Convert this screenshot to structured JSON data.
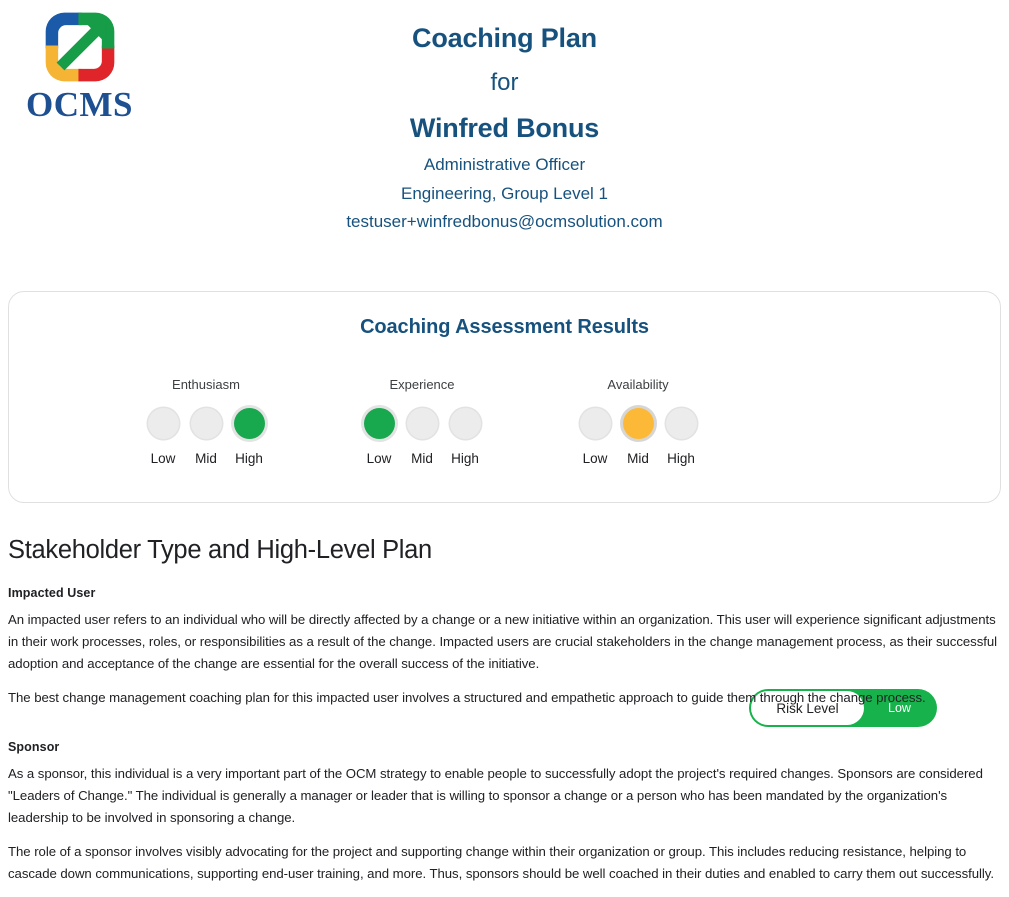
{
  "brand": {
    "logo_icon": "ocms-arrow-logo-icon",
    "name": "OCMS",
    "logo_colors": {
      "blue": "#1b5aa8",
      "green": "#179c48",
      "amber": "#f5b433",
      "red": "#e0252a"
    }
  },
  "header": {
    "title": "Coaching Plan",
    "for_word": "for",
    "person_name": "Winfred Bonus",
    "role": "Administrative Officer",
    "department": "Engineering, Group Level 1",
    "email": "testuser+winfredbonus@ocmsolution.com",
    "accent_color": "#17527e"
  },
  "assessment": {
    "card_title": "Coaching Assessment Results",
    "scale": [
      "Low",
      "Mid",
      "High"
    ],
    "meters": [
      {
        "label": "Enthusiasm",
        "selected": "High",
        "selected_index": 2,
        "state_color": "#18a84d"
      },
      {
        "label": "Experience",
        "selected": "Low",
        "selected_index": 0,
        "state_color": "#18a84d"
      },
      {
        "label": "Availability",
        "selected": "Mid",
        "selected_index": 1,
        "state_color": "#fcb938"
      }
    ],
    "risk": {
      "label": "Risk Level",
      "value": "Low",
      "color": "#18b24c"
    }
  },
  "plan_section": {
    "heading": "Stakeholder Type and High-Level Plan",
    "groups": [
      {
        "subheading": "Impacted User",
        "paragraphs": [
          "An impacted user refers to an individual who will be directly affected by a change or a new initiative within an organization. This user will experience significant adjustments in their work processes, roles, or responsibilities as a result of the change. Impacted users are crucial stakeholders in the change management process, as their successful adoption and acceptance of the change are essential for the overall success of the initiative.",
          "The best change management coaching plan for this impacted user involves a structured and empathetic approach to guide them through the change process."
        ]
      },
      {
        "subheading": "Sponsor",
        "paragraphs": [
          "As a sponsor, this individual is a very important part of the OCM strategy to enable people to successfully adopt the project's required changes. Sponsors are considered \"Leaders of Change.\" The individual is generally a manager or leader that is willing to sponsor a change or a person who has been mandated by the organization's leadership to be involved in sponsoring a change.",
          "The role of a sponsor involves visibly advocating for the project and supporting change within their organization or group. This includes reducing resistance, helping to cascade down communications, supporting end-user training, and more. Thus, sponsors should be well coached in their duties and enabled to carry them out successfully."
        ]
      }
    ]
  }
}
